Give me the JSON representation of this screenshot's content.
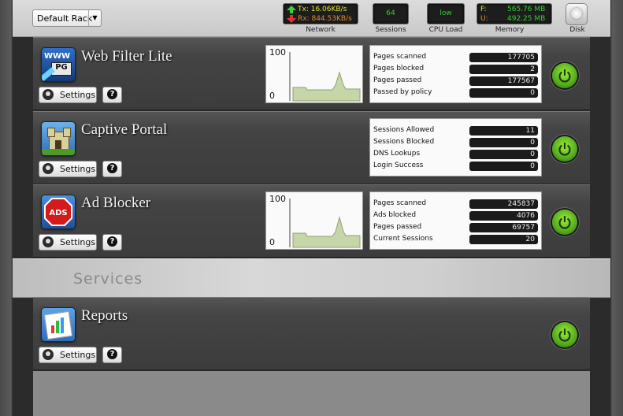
{
  "toolbar": {
    "rack_select": "Default Rack",
    "network": {
      "tx": "Tx:  16.06KB/s",
      "rx": "Rx:  844.53KB/s",
      "label": "Network"
    },
    "sessions": {
      "value": "64",
      "label": "Sessions"
    },
    "cpu": {
      "value": "low",
      "label": "CPU Load"
    },
    "memory": {
      "free_label": "F:",
      "free": "565.76 MB",
      "used_label": "U:",
      "used": "492.25 MB",
      "label": "Memory"
    },
    "disk": {
      "label": "Disk"
    }
  },
  "apps": [
    {
      "title": "Web Filter Lite",
      "icon": "www-pg-icon",
      "settings_label": "Settings",
      "help_label": "?",
      "graph": {
        "max": "100",
        "min": "0"
      },
      "stats": [
        {
          "name": "Pages scanned",
          "value": "177705"
        },
        {
          "name": "Pages blocked",
          "value": "2"
        },
        {
          "name": "Pages passed",
          "value": "177567"
        },
        {
          "name": "Passed by policy",
          "value": "0"
        }
      ]
    },
    {
      "title": "Captive Portal",
      "icon": "castle-icon",
      "settings_label": "Settings",
      "help_label": "?",
      "stats": [
        {
          "name": "Sessions Allowed",
          "value": "11"
        },
        {
          "name": "Sessions Blocked",
          "value": "0"
        },
        {
          "name": "DNS Lookups",
          "value": "0"
        },
        {
          "name": "Login Success",
          "value": "0"
        }
      ]
    },
    {
      "title": "Ad Blocker",
      "icon": "ads-stop-icon",
      "settings_label": "Settings",
      "help_label": "?",
      "graph": {
        "max": "100",
        "min": "0"
      },
      "stats": [
        {
          "name": "Pages scanned",
          "value": "245837"
        },
        {
          "name": "Ads blocked",
          "value": "4076"
        },
        {
          "name": "Pages passed",
          "value": "69757"
        },
        {
          "name": "Current Sessions",
          "value": "20"
        }
      ]
    }
  ],
  "services_label": "Services",
  "services": [
    {
      "title": "Reports",
      "icon": "reports-chart-icon",
      "settings_label": "Settings",
      "help_label": "?"
    }
  ],
  "colors": {
    "power_on": "#5cc21f",
    "tx": "#e0e030",
    "rx": "#e08a30",
    "meter_text": "#2fd02f"
  }
}
